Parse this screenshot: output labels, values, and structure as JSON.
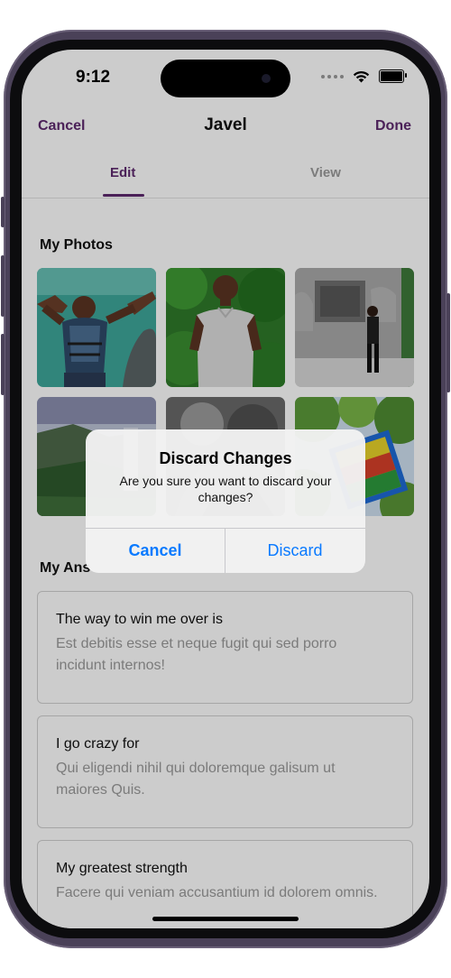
{
  "status": {
    "time": "9:12"
  },
  "nav": {
    "cancel": "Cancel",
    "title": "Javel",
    "done": "Done"
  },
  "tabs": {
    "edit": "Edit",
    "view": "View",
    "active": "Edit"
  },
  "photos": {
    "title": "My Photos",
    "items": [
      {
        "icon": "photo-man-life-vest-water"
      },
      {
        "icon": "photo-man-white-shirt-greenery"
      },
      {
        "icon": "photo-man-stone-monument"
      },
      {
        "icon": "photo-landscape-waterfall"
      },
      {
        "icon": "photo-black-white-statue"
      },
      {
        "icon": "photo-colorful-sign-trees"
      }
    ]
  },
  "answers": {
    "title": "My Ans",
    "items": [
      {
        "question": "The way to win me over is",
        "answer": "Est debitis esse et neque fugit qui sed porro incidunt internos!"
      },
      {
        "question": "I go crazy for",
        "answer": "Qui eligendi nihil qui doloremque galisum ut maiores Quis."
      },
      {
        "question": "My greatest strength",
        "answer": "Facere qui veniam accusantium id dolorem omnis."
      }
    ]
  },
  "alert": {
    "title": "Discard Changes",
    "message": "Are you sure you want to discard your changes?",
    "cancel": "Cancel",
    "discard": "Discard"
  },
  "colors": {
    "accent": "#5e2a6e",
    "ios_blue": "#0a7aff",
    "placeholder": "#9a9a9a"
  }
}
